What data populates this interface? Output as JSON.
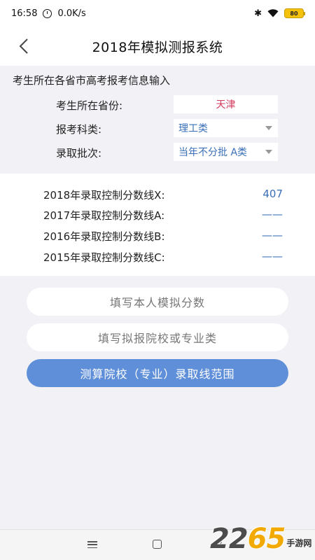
{
  "status_bar": {
    "time": "16:58",
    "network_speed": "0.0K/s",
    "battery": "80",
    "icons": [
      "alarm-icon",
      "bluetooth-icon",
      "wifi-icon",
      "battery-icon"
    ]
  },
  "header": {
    "title": "2018年模拟测报系统",
    "back_icon": "chevron-left-icon"
  },
  "input_section": {
    "heading": "考生所在各省市高考报考信息输入",
    "province_label": "考生所在省份:",
    "province_value": "天津",
    "subject_label": "报考科类:",
    "subject_value": "理工类",
    "batch_label": "录取批次:",
    "batch_value": "当年不分批 A类"
  },
  "score_lines": [
    {
      "label": "2018年录取控制分数线X:",
      "value": "407"
    },
    {
      "label": "2017年录取控制分数线A:",
      "value": "——"
    },
    {
      "label": "2016年录取控制分数线B:",
      "value": "——"
    },
    {
      "label": "2015年录取控制分数线C:",
      "value": "——"
    }
  ],
  "buttons": {
    "fill_score": "填写本人模拟分数",
    "fill_school": "填写拟报院校或专业类",
    "calculate": "测算院校（专业）录取线范围"
  },
  "watermark": {
    "number": "2265",
    "site": "手游网"
  },
  "colors": {
    "primary": "#5f8fd8",
    "value_blue": "#3a6fb8",
    "province_red": "#d23a5c",
    "background": "#f1f1f6"
  }
}
